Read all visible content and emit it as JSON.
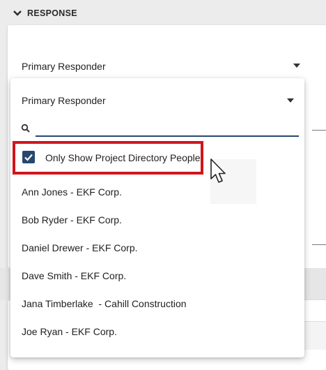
{
  "section": {
    "title": "RESPONSE",
    "icon": "chevron-down-icon"
  },
  "background_field": {
    "label": "Primary Responder",
    "icon": "dropdown-arrow-icon"
  },
  "dropdown": {
    "title": "Primary Responder",
    "search": {
      "value": "",
      "placeholder": "",
      "icon": "search-icon"
    },
    "filter_checkbox": {
      "label": "Only Show Project Directory People",
      "checked": true
    },
    "options": [
      "Ann Jones - EKF Corp.",
      "Bob Ryder - EKF Corp.",
      "Daniel Drewer - EKF Corp.",
      "Dave Smith - EKF Corp.",
      "Jana Timberlake  - Cahill Construction",
      "Joe Ryan - EKF Corp."
    ]
  },
  "colors": {
    "accent": "#27476e",
    "highlight": "#d0161c",
    "background": "#ececec"
  }
}
